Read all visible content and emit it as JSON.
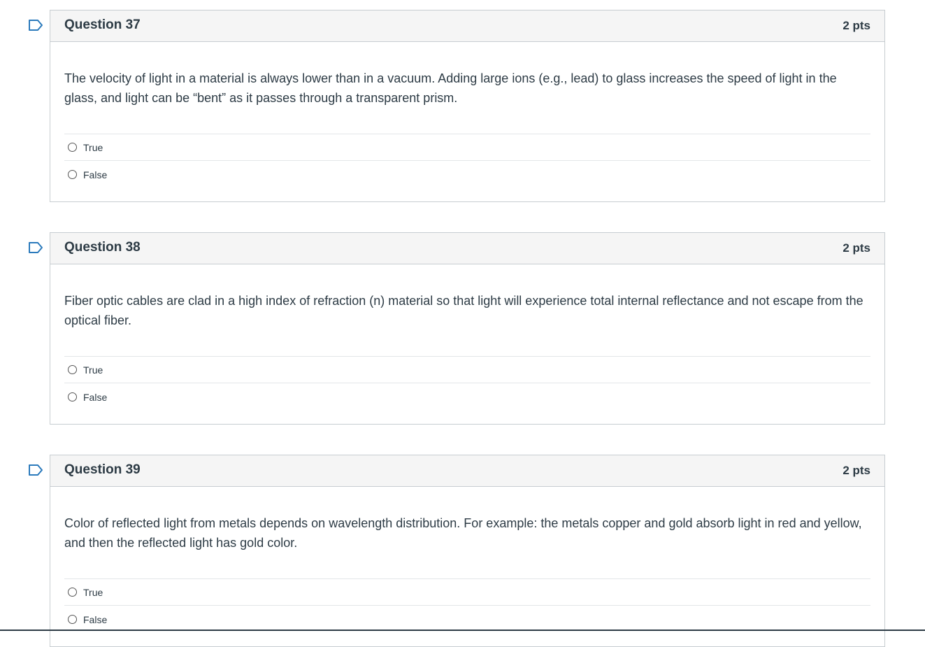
{
  "questions": [
    {
      "title": "Question 37",
      "points": "2 pts",
      "text": "The velocity of light in a material is always lower than in a vacuum. Adding large ions (e.g., lead) to glass increases the speed of light in the glass, and light can be “bent” as it passes through a transparent prism.",
      "answers": [
        "True",
        "False"
      ]
    },
    {
      "title": "Question 38",
      "points": "2 pts",
      "text": "Fiber optic cables are clad in a high index of refraction (n) material so that light will experience total internal reflectance and not escape from the optical fiber.",
      "answers": [
        "True",
        "False"
      ]
    },
    {
      "title": "Question 39",
      "points": "2 pts",
      "text": "Color of reflected light from metals depends on wavelength distribution. For example: the metals copper and gold absorb light in red and yellow, and then the reflected light has gold color.",
      "answers": [
        "True",
        "False"
      ]
    }
  ],
  "icons": {
    "flag": "flag-question-icon"
  },
  "colors": {
    "text": "#2d3b45",
    "header_bg": "#f5f5f5",
    "border": "#c7cdd1",
    "flag_stroke": "#2b7abc"
  }
}
